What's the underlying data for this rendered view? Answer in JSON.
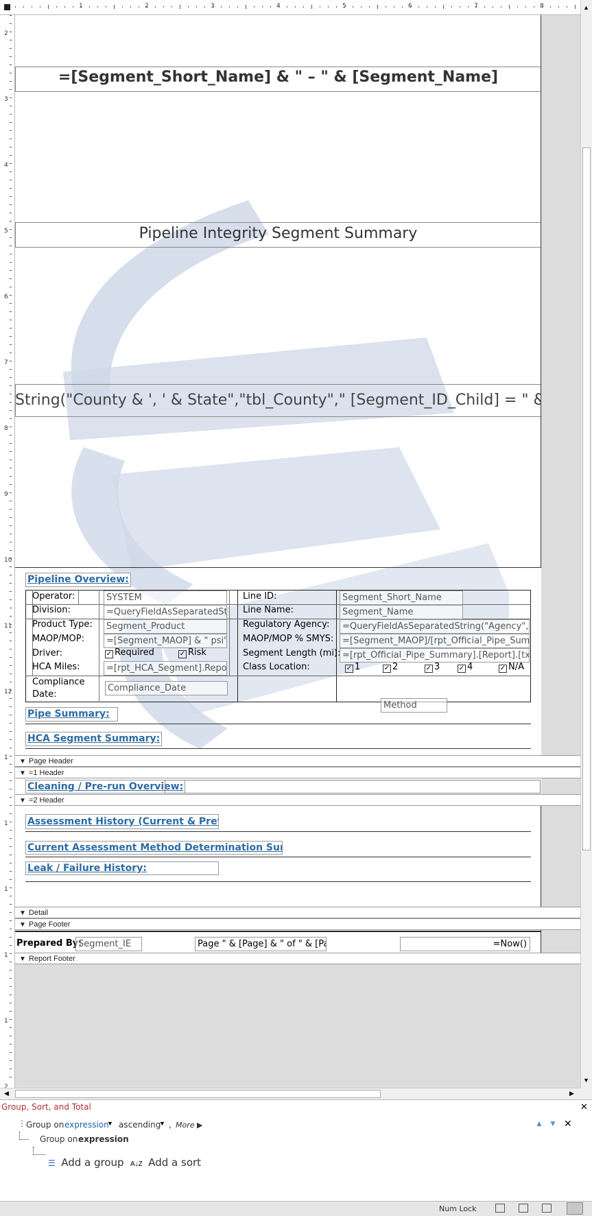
{
  "ruler": {
    "top_numbers": [
      "1",
      "2",
      "3",
      "4",
      "5",
      "6",
      "7",
      "8"
    ],
    "left_numbers": [
      "2",
      "3",
      "4",
      "5",
      "6",
      "7",
      "8",
      "9",
      "10",
      "11",
      "12",
      "1",
      "1",
      "1",
      "1",
      "1",
      "2"
    ]
  },
  "report": {
    "title_expr": "=[Segment_Short_Name] & \" – \" & [Segment_Name]",
    "subtitle": "Pipeline Integrity Segment Summary",
    "county_expr": "String(\"County & ', ' & State\",\"tbl_County\",\" [Segment_ID_Child] = \" & [S",
    "overview_title": "Pipeline Overview:",
    "rows": {
      "operator_label": "Operator:",
      "operator_value": "SYSTEM",
      "division_label": "Division:",
      "division_value": "=QueryFieldAsSeparatedStri",
      "product_label": "Product Type:",
      "product_value": "Segment_Product",
      "maop_label": "MAOP/MOP:",
      "maop_value": "=[Segment_MAOP] & \" psi\"",
      "driver_label": "Driver:",
      "driver_opt1": "Required",
      "driver_opt2": "Risk",
      "hca_label": "HCA Miles:",
      "hca_value": "=[rpt_HCA_Segment].Report",
      "compliance_label_1": "Compliance",
      "compliance_label_2": "Date:",
      "compliance_value": "Compliance_Date",
      "lineid_label": "Line ID:",
      "lineid_value": "Segment_Short_Name",
      "linename_label": "Line Name:",
      "linename_value": "Segment_Name",
      "agency_label": "Regulatory Agency:",
      "agency_value": "=QueryFieldAsSeparatedString(\"Agency\",\"q",
      "smys_label": "MAOP/MOP % SMYS:",
      "smys_value": "=[Segment_MAOP]/[rpt_Official_Pipe_Summ",
      "length_label": "Segment Length (mi):",
      "length_value": "=[rpt_Official_Pipe_Summary].[Report].[txt",
      "class_label": "Class Location:",
      "class_opts": [
        "1",
        "2",
        "3",
        "4",
        "N/A"
      ],
      "method_value": "Method"
    },
    "pipe_summary": "Pipe Summary:",
    "hca_summary": "HCA Segment Summary:",
    "cleaning": "Cleaning / Pre-run Overview:",
    "assessment": "Assessment History (Current & Previous):",
    "method_det": "Current Assessment Method Determination Summary:",
    "leak": "Leak / Failure History:",
    "footer": {
      "prepared_label": "Prepared By:",
      "prepared_value": "Segment_IE",
      "page_expr": "Page \" & [Page] & \" of \" & [Page",
      "now_expr": "=Now()"
    }
  },
  "bands": {
    "page_header": "Page Header",
    "h1": "=1 Header",
    "h2": "=2 Header",
    "detail": "Detail",
    "page_footer": "Page Footer",
    "report_footer": "Report Footer"
  },
  "group_panel": {
    "title": "Group, Sort, and Total",
    "group_on": "Group on",
    "expression": "expression",
    "ascending": "ascending",
    "comma": ",",
    "more": "More ▶",
    "group_on_2": "Group on",
    "expression_2": "expression",
    "add_group": "Add a group",
    "add_sort": "Add a sort"
  },
  "status": {
    "numlock": "Num Lock"
  },
  "colors": {
    "section_blue": "#2e6ca4",
    "watermark": "#cfd8e8",
    "group_title": "#b03030",
    "link_blue": "#1f5fb4"
  }
}
